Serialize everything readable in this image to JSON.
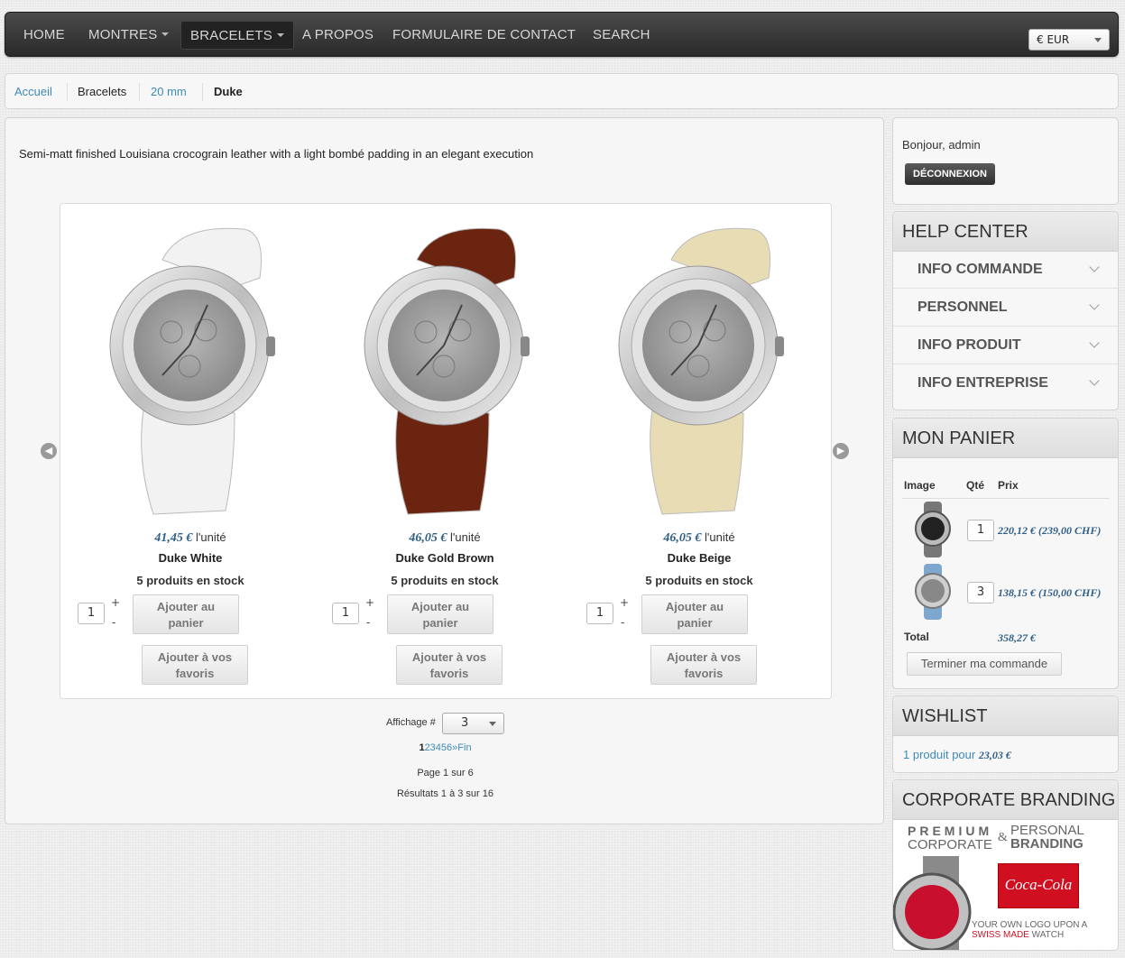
{
  "nav": {
    "items": [
      {
        "label": "HOME"
      },
      {
        "label": "MONTRES"
      },
      {
        "label": "BRACELETS"
      },
      {
        "label": "A PROPOS"
      },
      {
        "label": "FORMULAIRE DE CONTACT"
      },
      {
        "label": "SEARCH"
      }
    ],
    "currency": "€ EUR"
  },
  "breadcrumb": [
    "Accueil",
    "Bracelets",
    "20 mm",
    "Duke"
  ],
  "description": "Semi-matt finished Louisiana crocograin leather with a light bombé padding in an elegant execution",
  "products": [
    {
      "price": "41,45 €",
      "unit": " l'unité",
      "name": "Duke White",
      "stock": "5 produits en stock",
      "qty": "1",
      "strap_color": "#f2f2f2"
    },
    {
      "price": "46,05 €",
      "unit": " l'unité",
      "name": "Duke Gold Brown",
      "stock": "5 produits en stock",
      "qty": "1",
      "strap_color": "#6b2410"
    },
    {
      "price": "46,05 €",
      "unit": " l'unité",
      "name": "Duke Beige",
      "stock": "5 produits en stock",
      "qty": "1",
      "strap_color": "#e8dcb5"
    }
  ],
  "product_buttons": {
    "plus": "+",
    "minus": "-",
    "add_cart_line1": "Ajouter au",
    "add_cart_line2": "panier",
    "add_fav_line1": "Ajouter à vos",
    "add_fav_line2": "favoris"
  },
  "pager": {
    "label": "Affichage #",
    "value": "3",
    "current": "1",
    "pages": "23456",
    "next": "»",
    "end": "Fin",
    "page_info": "Page 1 sur 6",
    "results": "Résultats 1 à 3 sur 16"
  },
  "user": {
    "greeting": "Bonjour, admin",
    "logout": "DÉCONNEXION"
  },
  "help_center": {
    "title": "HELP CENTER",
    "items": [
      "INFO COMMANDE",
      "PERSONNEL",
      "INFO PRODUIT",
      "INFO ENTREPRISE"
    ]
  },
  "cart": {
    "title": "MON PANIER",
    "headers": {
      "image": "Image",
      "qty": "Qté",
      "price": "Prix"
    },
    "items": [
      {
        "qty": "1",
        "price": "220,12 € (239,00 CHF)"
      },
      {
        "qty": "3",
        "price": "138,15 € (150,00 CHF)"
      }
    ],
    "total_label": "Total",
    "total_value": "358,27 €",
    "checkout": "Terminer ma commande"
  },
  "wishlist": {
    "title": "WISHLIST",
    "text": "1 produit pour ",
    "value": "23,03 €"
  },
  "branding": {
    "title": "CORPORATE BRANDING",
    "line1a": "PREMIUM",
    "line1b": "PERSONAL",
    "line2a": "CORPORATE",
    "amp": "&",
    "line2b": "BRANDING",
    "logo_text": "Coca-Cola",
    "tag1": "YOUR OWN LOGO UPON A",
    "tag2a": "SWISS MADE",
    "tag2b": " WATCH"
  },
  "colors": {
    "link": "#3d8ab8",
    "price": "#2f5f86",
    "nav_bg": "#333333"
  }
}
